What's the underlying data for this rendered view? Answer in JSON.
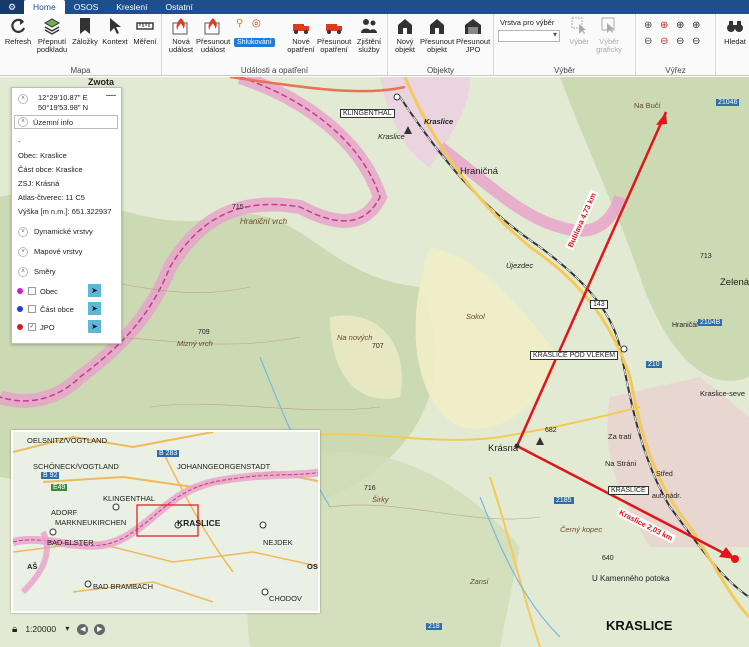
{
  "app": {
    "menu_icon": "gear-icon"
  },
  "tabs": [
    {
      "label": "Home",
      "active": true
    },
    {
      "label": "OSOS",
      "active": false
    },
    {
      "label": "Kreslení",
      "active": false
    },
    {
      "label": "Ostatní",
      "active": false
    }
  ],
  "ribbon": {
    "groups": {
      "mapa": "Mapa",
      "udalosti": "Události a opatření",
      "objekty": "Objekty",
      "vyber": "Výběr",
      "vyrez": "Výřez"
    },
    "buttons": {
      "refresh": "Refresh",
      "prepnuti": "Přepnutí podkladu",
      "zalozky": "Záložky",
      "kontext": "Kontext",
      "mereni": "Měření",
      "nova_udalost": "Nová událost",
      "presunout_udalost": "Přesunout událost",
      "shlukovani": "Shlukování",
      "nove_opatreni": "Nové opatření",
      "presunout_opatreni": "Přesunout opatření",
      "zjisteni_sluzby": "Zjištění služby",
      "novy_objekt": "Nový objekt",
      "presunout_objekt": "Přesunout objekt",
      "presunout_jpo": "Přesunout JPO",
      "vrstva_label": "Vrstva pro výběr",
      "vyber": "Výběr",
      "vyber_graficky": "Výběr graficky",
      "hledat": "Hledat"
    }
  },
  "panel": {
    "lon": "12°29'10.87\" E",
    "lat": "50°19'53.98\" N",
    "uzemni_info": "Územní info",
    "dash": "-",
    "obec": "Obec: Kraslice",
    "cast_obce": "Část obce: Kraslice",
    "zsj": "ZSJ: Krásná",
    "atlas": "Atlas-čtverec: 11 C5",
    "vyska": "Výška [m n.m.]: 651.322937",
    "dynamicke": "Dynamické vrstvy",
    "mapove": "Mapové vrstvy",
    "smery": "Směry",
    "smery_items": [
      {
        "label": "Obec",
        "color": "#d21ad2",
        "checked": false
      },
      {
        "label": "Část obce",
        "color": "#1f3fd6",
        "checked": false
      },
      {
        "label": "JPO",
        "color": "#d81c1c",
        "checked": true
      }
    ]
  },
  "map": {
    "labels": {
      "zwota": "Zwota",
      "klingenthal": "KLINGENTHAL",
      "kraslice_top": "Kraslice",
      "kraslice_small": "Kraslice",
      "hranicna": "Hraničná",
      "hranicni_vrch": "Hraniční vrch",
      "mizny_vrch": "Mizný vrch",
      "na_novych": "Na nových",
      "sokol": "Sokol",
      "krasna": "Krásná",
      "krasna_pod_vlekem": "KRASLICE POD VLEKEM",
      "kraslice_stop": "KRASLICE",
      "zelena": "Zelená",
      "kraslice_sev": "Kraslice-seve",
      "cerny_kopec": "Černý kopec",
      "u_kamenneho": "U Kamenného potoka",
      "zatrat": "Za tratí",
      "na_strani": "Na Stráni",
      "stred": "Střed",
      "aut_nadr": "aut. nádr.",
      "sirky": "Širky",
      "zansi": "Zansi",
      "na_bucich": "Na Bučí",
      "kraslice_big": "KRASLICE",
      "hranicar": "Hraničář",
      "ujezdec": "Újezdec",
      "road_21046_a": "21046",
      "road_21046_b": "2104B",
      "road_210": "210",
      "road_218": "218",
      "road_2185": "2185",
      "road_143": "143",
      "el_715": "715",
      "el_709": "709",
      "el_707": "707",
      "el_682": "682",
      "el_716": "716",
      "el_640": "640",
      "el_713": "713"
    },
    "routes": [
      {
        "label": "Bublava 4,73 km",
        "color": "#e0161a"
      },
      {
        "label": "Kraslice 2,03 km",
        "color": "#e0161a"
      }
    ]
  },
  "overview": {
    "oelsnitz": "OELSNITZ/VOGTLAND",
    "schoneck": "SCHÖNECK/VOGTLAND",
    "johanngeorgenstadt": "JOHANNGEORGENSTADT",
    "klingenthal": "KLINGENTHAL",
    "adorf": "ADORF",
    "markneukirchen": "MARKNEUKIRCHEN",
    "kraslice": "KRASLICE",
    "bad_elster": "BAD ELSTER",
    "nejdek": "NEJDEK",
    "as": "AŠ",
    "os": "OS",
    "bad_brambach": "BAD BRAMBACH",
    "chodov": "CHODOV",
    "b283": "B 283",
    "b92": "B 92",
    "e49": "E49"
  },
  "bottom": {
    "scale": "1:20000",
    "lock_icon": "lock-icon"
  },
  "colors": {
    "accent": "#1e4e8c",
    "border": "#e78fbf",
    "route": "#e0161a",
    "road": "#f4c95a"
  }
}
